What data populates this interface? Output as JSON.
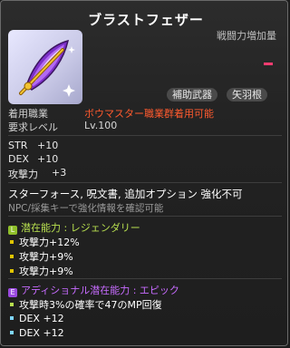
{
  "title": "ブラストフェザー",
  "combat_power_label": "戦闘力増加量",
  "colors": {
    "red_accent": "#ff3c70",
    "job_red": "#ff5a2e",
    "legendary": "#b8e04f",
    "epic": "#c76bff"
  },
  "badges": [
    "補助武器",
    "矢羽根"
  ],
  "requirements": {
    "job_label": "着用職業",
    "job_value": "ボウマスター職業群着用可能",
    "level_label": "要求レベル",
    "level_value": "Lv.100"
  },
  "stats": [
    {
      "name": "STR",
      "value": "+10"
    },
    {
      "name": "DEX",
      "value": "+10"
    },
    {
      "name": "攻撃力",
      "value": "+3"
    }
  ],
  "note_line1": "スターフォース, 呪文書, 追加オプション 強化不可",
  "note_line2": "NPC/採集キーで強化情報を確認可能",
  "potential": {
    "tag": "L",
    "title": "潜在能力 : レジェンダリー",
    "lines": [
      "攻撃力+12%",
      "攻撃力+9%",
      "攻撃力+9%"
    ]
  },
  "additional": {
    "tag": "E",
    "title": "アディショナル潜在能力 : エピック",
    "lines": [
      "攻撃時3%の確率で47のMP回復",
      "DEX +12",
      "DEX +12"
    ]
  },
  "icons": [
    "feather-icon",
    "red-dash-icon"
  ]
}
